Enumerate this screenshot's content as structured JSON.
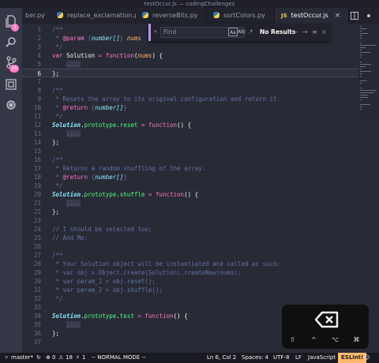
{
  "window": {
    "title": "testOccur.js — codingChallenges"
  },
  "tabs": [
    {
      "label": "ber.py",
      "lang": "py"
    },
    {
      "label": "replace_exclamation.py",
      "lang": "py"
    },
    {
      "label": "reverseBits.py",
      "lang": "py"
    },
    {
      "label": "sortColors.py",
      "lang": "py"
    },
    {
      "label": "testOccur.js",
      "lang": "js",
      "active": true
    }
  ],
  "tab_icons": {
    "js": "JS",
    "close": "×"
  },
  "activity_bar": {
    "explorer_badge": "1",
    "git_badge": "16",
    "icons": [
      "files-icon",
      "search-icon",
      "source-control-icon",
      "extensions-icon",
      "debug-icon"
    ]
  },
  "find_widget": {
    "placeholder": "Find",
    "match_case": "Aa",
    "whole_word": "Ab|",
    "regex": ".*",
    "result": "No Results"
  },
  "editor": {
    "current_line": 6,
    "lines": [
      [
        [
          "c",
          "/**"
        ]
      ],
      [
        [
          "c",
          " * "
        ],
        [
          "tag",
          "@param"
        ],
        [
          "c",
          " {"
        ],
        [
          "tp",
          "number[]"
        ],
        [
          "c",
          "} "
        ],
        [
          "pr",
          "nums"
        ]
      ],
      [
        [
          "c",
          " */"
        ]
      ],
      [
        [
          "k",
          "var "
        ],
        [
          "v",
          "Solution "
        ],
        [
          "k",
          "= "
        ],
        [
          "fn",
          "function"
        ],
        [
          "v",
          "("
        ],
        [
          "pr",
          "nums"
        ],
        [
          "v",
          ") {"
        ]
      ],
      [
        [
          "v",
          "    "
        ],
        [
          "fold",
          "...."
        ]
      ],
      [
        [
          "v",
          "};"
        ]
      ],
      [
        [
          "v",
          ""
        ]
      ],
      [
        [
          "c",
          "/**"
        ]
      ],
      [
        [
          "c",
          " * Resets the array to its original configuration and return it."
        ]
      ],
      [
        [
          "c",
          " * "
        ],
        [
          "tag",
          "@return"
        ],
        [
          "c",
          " {"
        ],
        [
          "tp",
          "number[]"
        ],
        [
          "c",
          "}"
        ]
      ],
      [
        [
          "c",
          " */"
        ]
      ],
      [
        [
          "cls",
          "Solution"
        ],
        [
          "v",
          "."
        ],
        [
          "prop",
          "prototype"
        ],
        [
          "v",
          "."
        ],
        [
          "prop",
          "reset "
        ],
        [
          "k",
          "= "
        ],
        [
          "fn",
          "function"
        ],
        [
          "v",
          "() {"
        ]
      ],
      [
        [
          "v",
          "    "
        ],
        [
          "fold",
          "...."
        ]
      ],
      [
        [
          "v",
          "};"
        ]
      ],
      [
        [
          "v",
          ""
        ]
      ],
      [
        [
          "c",
          "/**"
        ]
      ],
      [
        [
          "c",
          " * Returns a random shuffling of the array."
        ]
      ],
      [
        [
          "c",
          " * "
        ],
        [
          "tag",
          "@return"
        ],
        [
          "c",
          " {"
        ],
        [
          "tp",
          "number[]"
        ],
        [
          "c",
          "}"
        ]
      ],
      [
        [
          "c",
          " */"
        ]
      ],
      [
        [
          "cls",
          "Solution"
        ],
        [
          "v",
          "."
        ],
        [
          "prop",
          "prototype"
        ],
        [
          "v",
          "."
        ],
        [
          "prop",
          "shuffle "
        ],
        [
          "k",
          "= "
        ],
        [
          "fn",
          "function"
        ],
        [
          "v",
          "() {"
        ]
      ],
      [
        [
          "v",
          "    "
        ],
        [
          "fold",
          "...."
        ]
      ],
      [
        [
          "v",
          "};"
        ]
      ],
      [
        [
          "v",
          ""
        ]
      ],
      [
        [
          "c",
          "// I should be selected too;"
        ]
      ],
      [
        [
          "c",
          "// And Me;"
        ]
      ],
      [
        [
          "v",
          ""
        ]
      ],
      [
        [
          "c",
          "/**"
        ]
      ],
      [
        [
          "c",
          " * Your Solution object will be instantiated and called as such:"
        ]
      ],
      [
        [
          "c",
          " * var obj = Object.create(Solution).createNew(nums);"
        ]
      ],
      [
        [
          "c",
          " * var param_1 = obj.reset();"
        ]
      ],
      [
        [
          "c",
          " * var param_2 = obj.shuffle();"
        ]
      ],
      [
        [
          "c",
          " */"
        ]
      ],
      [
        [
          "v",
          ""
        ]
      ],
      [
        [
          "cls",
          "Solution"
        ],
        [
          "v",
          "."
        ],
        [
          "prop",
          "prototype"
        ],
        [
          "v",
          "."
        ],
        [
          "prop",
          "test "
        ],
        [
          "k",
          "= "
        ],
        [
          "fn",
          "function"
        ],
        [
          "v",
          "() {"
        ]
      ],
      [
        [
          "v",
          "    "
        ],
        [
          "fold",
          "...."
        ]
      ],
      [
        [
          "v",
          "};"
        ]
      ],
      [
        [
          "v",
          ""
        ]
      ]
    ]
  },
  "touch_bar": {
    "keys": [
      "⇧",
      "^",
      "⌥",
      "⌘"
    ]
  },
  "status_bar": {
    "branch": "master*",
    "errors": "0",
    "warnings": "18",
    "extra": "1",
    "mode": "-- NORMAL MODE --",
    "position": "Ln 6, Col 2",
    "spaces": "Spaces: 4",
    "encoding": "UTF-8",
    "eol": "LF",
    "language": "JavaScript",
    "linter": "ESLint!"
  },
  "colors": {
    "background": "#282a36",
    "accent": "#ff79c6",
    "comment": "#6272a4",
    "linter_badge": "#ffb86c"
  }
}
